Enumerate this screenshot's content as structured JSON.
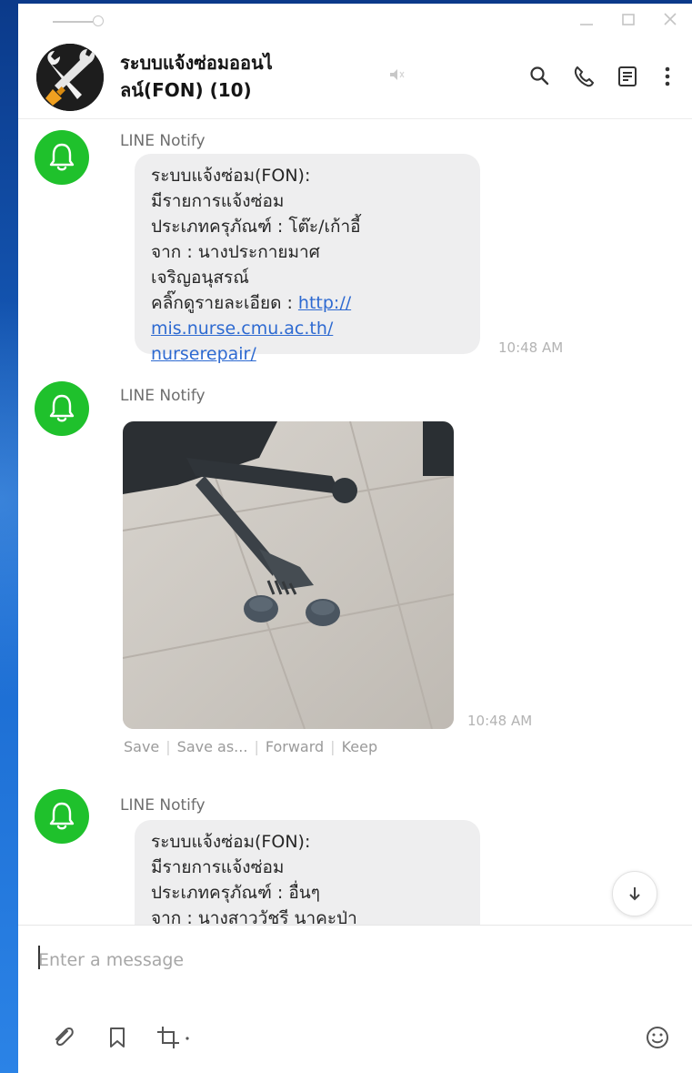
{
  "header": {
    "title_line1": "ระบบแจ้งซ่อมออนไ",
    "title_line2": "ลน์(FON) (10)"
  },
  "colors": {
    "notify_green": "#1fc12c",
    "link_blue": "#2e6ad1",
    "bubble": "#eeeeef",
    "desktop_blue": "#1565c8"
  },
  "icons": {
    "window": [
      "pin-icon",
      "minimize-icon",
      "maximize-icon",
      "close-icon"
    ],
    "header": [
      "volume-muted-icon",
      "search-icon",
      "phone-icon",
      "notes-icon",
      "more-vertical-icon"
    ],
    "toolbar": [
      "paperclip-icon",
      "bookmark-icon",
      "crop-icon",
      "emoji-icon"
    ]
  },
  "messages": [
    {
      "sender": "LINE Notify",
      "lines": [
        "ระบบแจ้งซ่อม(FON):",
        "มีรายการแจ้งซ่อม",
        "ประเภทครุภัณฑ์ : โต๊ะ/เก้าอี้",
        "จาก : นางประกายมาศ",
        "เจริญอนุสรณ์"
      ],
      "detail_prefix": "คลิ๊กดูรายละเอียด : ",
      "link_lines": [
        "http://",
        "mis.nurse.cmu.ac.th/",
        "nurserepair/"
      ],
      "time": "10:48 AM"
    },
    {
      "sender": "LINE Notify",
      "image": "photo of broken office chair base on tiled floor",
      "time": "10:48 AM",
      "actions": [
        "Save",
        "Save as...",
        "Forward",
        "Keep"
      ]
    },
    {
      "sender": "LINE Notify",
      "lines": [
        "ระบบแจ้งซ่อม(FON):",
        "มีรายการแจ้งซ่อม",
        "ประเภทครุภัณฑ์ : อื่นๆ",
        "จาก : นางสาววัชรี นาคะป่า"
      ]
    }
  ],
  "input": {
    "placeholder": "Enter a message"
  }
}
